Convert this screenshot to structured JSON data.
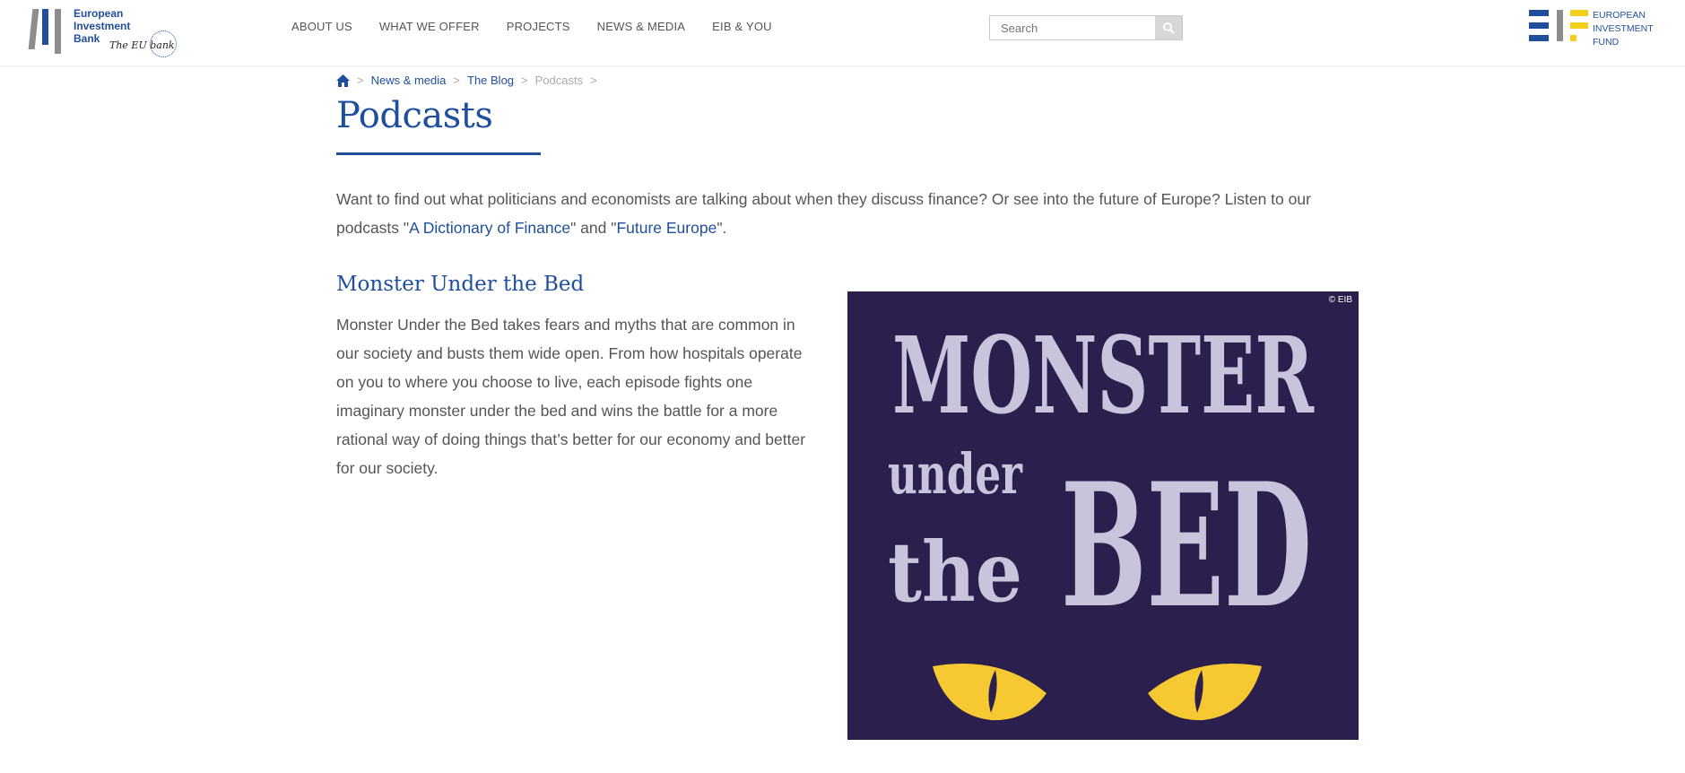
{
  "header": {
    "logo": {
      "name": "European Investment Bank",
      "lines": [
        "European",
        "Investment",
        "Bank"
      ],
      "slogan": "The EU bank"
    },
    "nav": [
      "ABOUT US",
      "WHAT WE OFFER",
      "PROJECTS",
      "NEWS & MEDIA",
      "EIB & YOU"
    ],
    "search_placeholder": "Search",
    "eif_logo": {
      "lines": [
        "EUROPEAN",
        "INVESTMENT",
        "FUND"
      ]
    }
  },
  "breadcrumb": {
    "items": [
      "News & media",
      "The Blog",
      "Podcasts"
    ],
    "separator": ">"
  },
  "page_title": "Podcasts",
  "intro": {
    "before": "Want to find out what politicians and economists are talking about when they discuss finance? Or see into the future of Europe? Listen to our podcasts \"",
    "link1": "A Dictionary of Finance",
    "middle": "\" and \"",
    "link2": "Future Europe",
    "after": "\"."
  },
  "podcast": {
    "title": "Monster Under the Bed",
    "description": "Monster Under the Bed takes fears and myths that are common in our society and busts them wide open. From how hospitals operate on you to where you choose to live, each episode fights one imaginary monster under the bed and wins the battle for a more rational way of doing things that’s better for our economy and better for our society.",
    "image": {
      "line1": "MONSTER",
      "line2a": "under",
      "line2b": "the",
      "line3": "BED",
      "credit": "© EIB"
    }
  },
  "colors": {
    "brand_blue": "#1f4f9c",
    "poster_bg": "#2a1f4d",
    "poster_text": "#c9c3dc",
    "eyes": "#f6c932",
    "eif_yellow": "#f3cf1c"
  }
}
